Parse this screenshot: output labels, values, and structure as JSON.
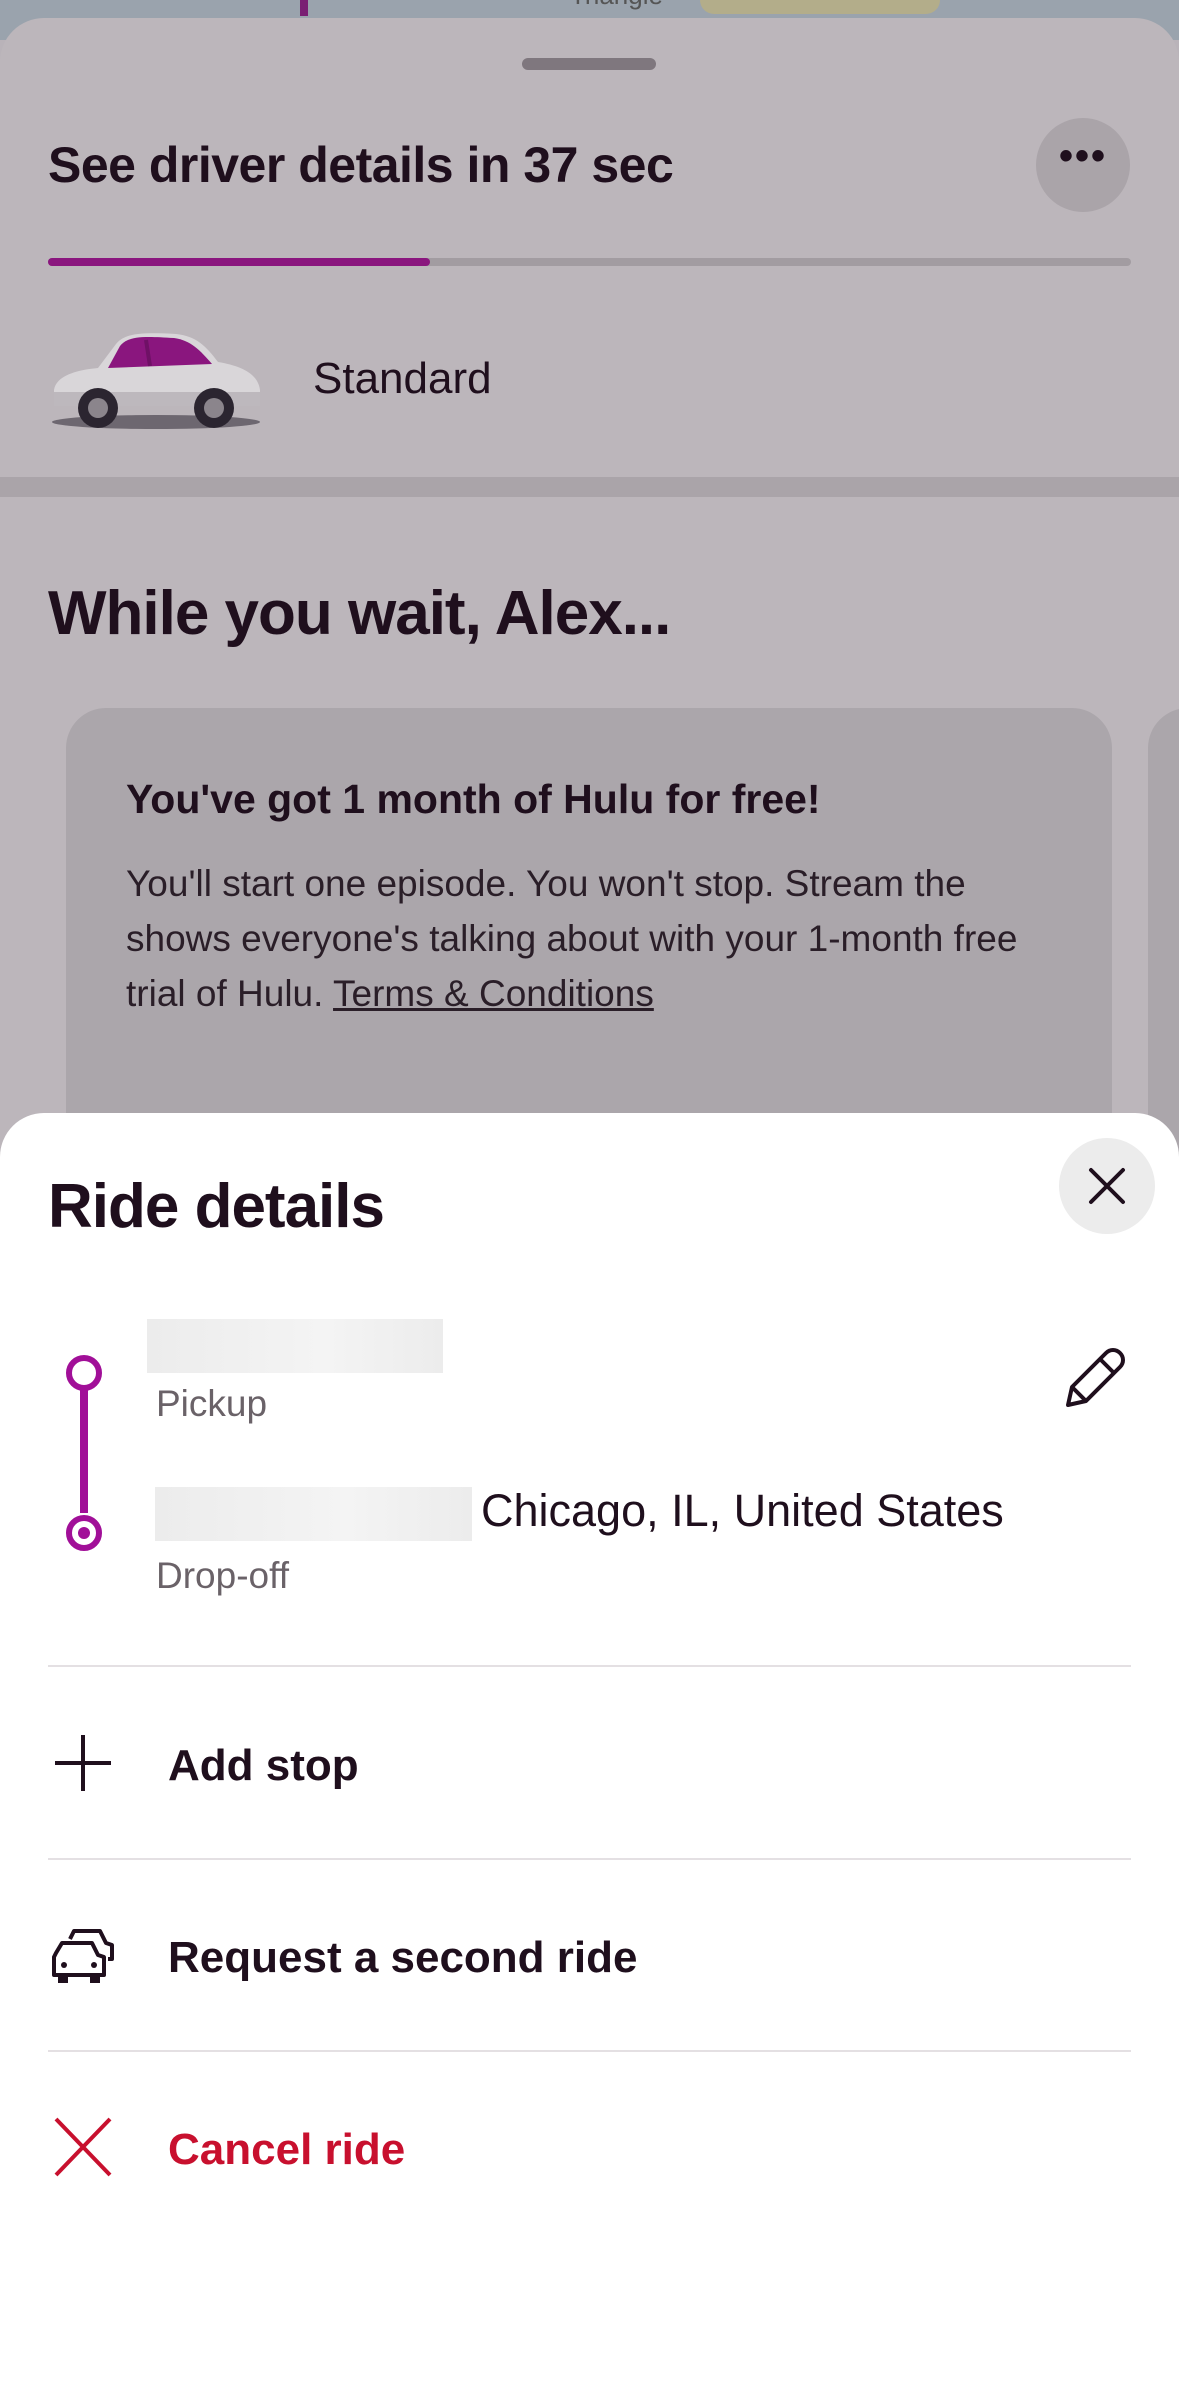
{
  "map": {
    "label": "Triangle"
  },
  "status_card": {
    "title": "See driver details in 37 sec",
    "more_icon": "•••",
    "progress_fraction": 0.353,
    "ride_type": "Standard"
  },
  "promo": {
    "heading": "While you wait, Alex...",
    "card_title": "You've got 1 month of Hulu for free!",
    "card_body": "You'll start one episode. You won't stop. Stream the shows everyone's talking about with your 1-month free trial of Hulu. ",
    "card_link": "Terms & Conditions"
  },
  "ride_details": {
    "title": "Ride details",
    "pickup_label": "Pickup",
    "dropoff_address_suffix": "Chicago, IL, United States",
    "dropoff_label": "Drop-off",
    "actions": [
      {
        "label": "Add stop",
        "icon": "plus-icon"
      },
      {
        "label": "Request a second ride",
        "icon": "cars-icon"
      },
      {
        "label": "Cancel ride",
        "icon": "x-icon"
      }
    ]
  },
  "colors": {
    "accent": "#8a167e",
    "route": "#a10f98",
    "danger": "#c8102e"
  }
}
